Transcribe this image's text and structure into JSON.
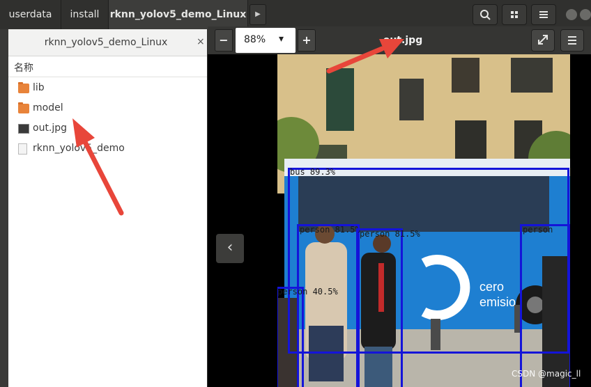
{
  "file_manager": {
    "path_crumbs": [
      "userdata",
      "install",
      "rknn_yolov5_demo_Linux"
    ],
    "tab_title": "rknn_yolov5_demo_Linux",
    "column_header": "名称",
    "files": [
      {
        "name": "lib",
        "type": "folder"
      },
      {
        "name": "model",
        "type": "folder"
      },
      {
        "name": "out.jpg",
        "type": "image"
      },
      {
        "name": "rknn_yolov5_demo",
        "type": "binary"
      }
    ]
  },
  "viewer": {
    "title": "out.jpg",
    "zoom": "88%",
    "zoom_out_label": "−",
    "zoom_in_label": "+",
    "prev_label": "‹",
    "detections": [
      {
        "label": "bus 89.3%"
      },
      {
        "label": "person 81.5%"
      },
      {
        "label": "person 81.5%"
      },
      {
        "label": "person 40.5%"
      },
      {
        "label": "person"
      }
    ]
  },
  "watermark": "CSDN @magic_ll",
  "colors": {
    "accent_arrow": "#e8463a",
    "detection_box": "#1414d9",
    "folder": "#e8833a"
  }
}
